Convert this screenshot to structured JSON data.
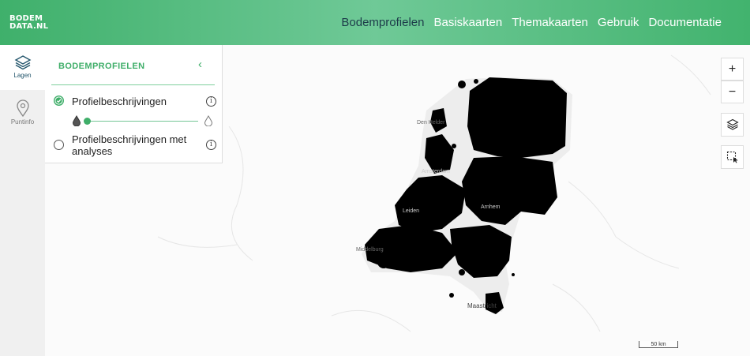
{
  "header": {
    "logo_line1": "BODEM",
    "logo_line2": "DATA.NL",
    "nav": [
      "Bodemprofielen",
      "Basiskaarten",
      "Themakaarten",
      "Gebruik",
      "Documentatie"
    ]
  },
  "rail": {
    "lagen_label": "Lagen",
    "puntinfo_label": "Puntinfo"
  },
  "panel": {
    "title": "BODEMPROFIELEN",
    "collapse_glyph": "‹",
    "layers": [
      {
        "label": "Profielbeschrijvingen",
        "checked": true
      },
      {
        "label_line1": "Profielbeschrijvingen met",
        "label_line2": "analyses",
        "checked": false
      }
    ],
    "opacity": 0
  },
  "map_controls": {
    "zoom_in": "+",
    "zoom_out": "−",
    "layers_icon": "layers-icon",
    "select_icon": "select-area-icon"
  },
  "map": {
    "labels": [
      "Den Helder",
      "Amsterdam",
      "Arnhem",
      "Middelburg",
      "Maastricht",
      "Leiden"
    ],
    "scale_text": "50 km"
  },
  "colors": {
    "accent": "#3fae69",
    "nav_active": "#1d3b4a"
  }
}
